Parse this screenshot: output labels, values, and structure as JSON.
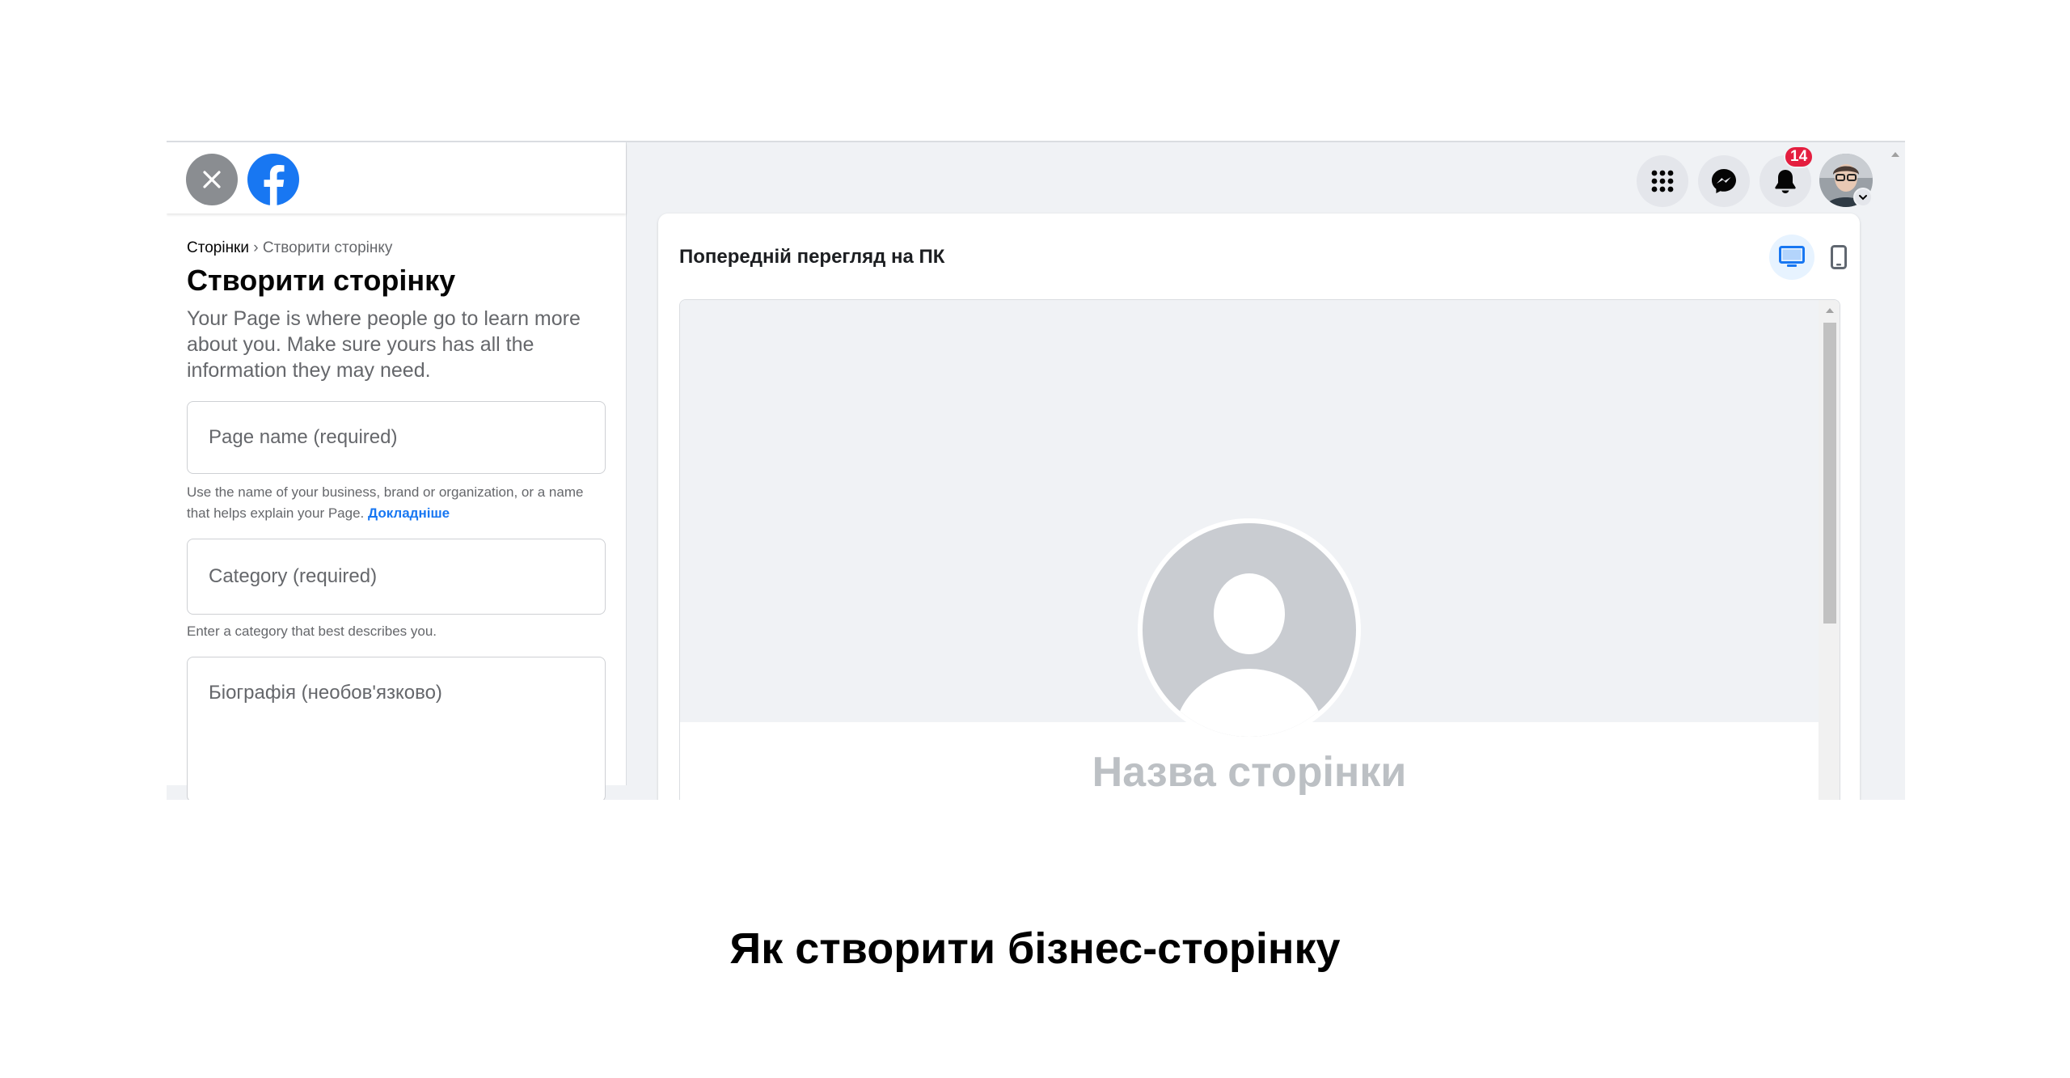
{
  "left_panel": {
    "breadcrumb": {
      "root": "Сторінки",
      "separator": " › ",
      "current": "Створити сторінку"
    },
    "title": "Створити сторінку",
    "intro": "Your Page is where people go to learn more about you. Make sure yours has all the information they may need.",
    "page_name_field": {
      "placeholder": "Page name (required)",
      "hint": "Use the name of your business, brand or organization, or a name that helps explain your Page.",
      "learn_more": "Докладніше"
    },
    "category_field": {
      "placeholder": "Category (required)",
      "hint": "Enter a category that best describes you."
    },
    "bio_field": {
      "placeholder": "Біографія (необов'язково)"
    }
  },
  "top_nav": {
    "icons": [
      "apps-grid-icon",
      "messenger-icon",
      "bell-icon",
      "avatar",
      "chevron-down-icon"
    ],
    "notification_count": "14"
  },
  "preview": {
    "title": "Попередній перегляд на ПК",
    "selected_view": "desktop",
    "page_name_placeholder": "Назва сторінки"
  },
  "caption": "Як створити бізнес-сторінку",
  "colors": {
    "brand_blue": "#1877f2",
    "badge_red": "#e41e3f",
    "background_gray": "#f0f2f5"
  }
}
